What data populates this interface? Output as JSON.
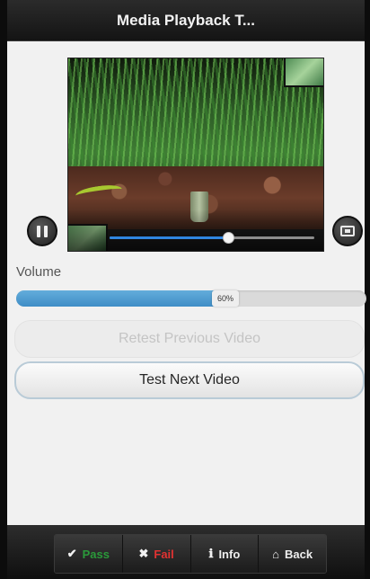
{
  "window": {
    "title": "Media Playback T..."
  },
  "player": {
    "progress_fraction": 0.58,
    "pause_icon": "pause-icon",
    "fullscreen_icon": "fullscreen-icon"
  },
  "volume": {
    "label": "Volume",
    "value_text": "60%",
    "value_fraction": 0.6
  },
  "buttons": {
    "retest": "Retest Previous Video",
    "next": "Test Next Video"
  },
  "bottom_bar": {
    "pass": "Pass",
    "fail": "Fail",
    "info": "Info",
    "back": "Back",
    "pass_icon": "check-icon",
    "fail_icon": "close-icon",
    "info_icon": "info-icon",
    "back_icon": "home-icon"
  },
  "colors": {
    "accent_blue": "#3f8dc6",
    "pass_green": "#2a9a3a",
    "fail_red": "#e13232"
  }
}
